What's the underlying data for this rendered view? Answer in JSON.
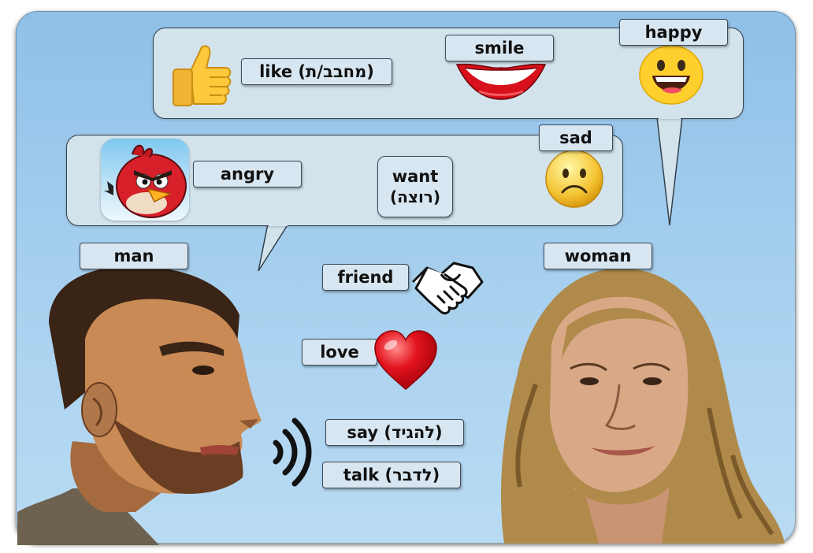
{
  "labels": {
    "happy": "happy",
    "smile": "smile",
    "like": "like (מחבב/ת)",
    "sad": "sad",
    "angry": "angry",
    "want": "want",
    "want_hebrew": "(רוצה)",
    "man": "man",
    "woman": "woman",
    "friend": "friend",
    "love": "love",
    "say": "say (להגיד)",
    "talk": "talk (לדבר)"
  },
  "colors": {
    "background": "#9cc8ec",
    "bubble": "#d3e3ec",
    "label": "#d7e6f1",
    "heart": "#e0151f",
    "emoji_yellow": "#ffcc33"
  },
  "icons": [
    "thumbs-up-icon",
    "lips-icon",
    "happy-face-icon",
    "angry-bird-icon",
    "sad-face-icon",
    "handshake-icon",
    "heart-icon",
    "sound-waves-icon"
  ]
}
